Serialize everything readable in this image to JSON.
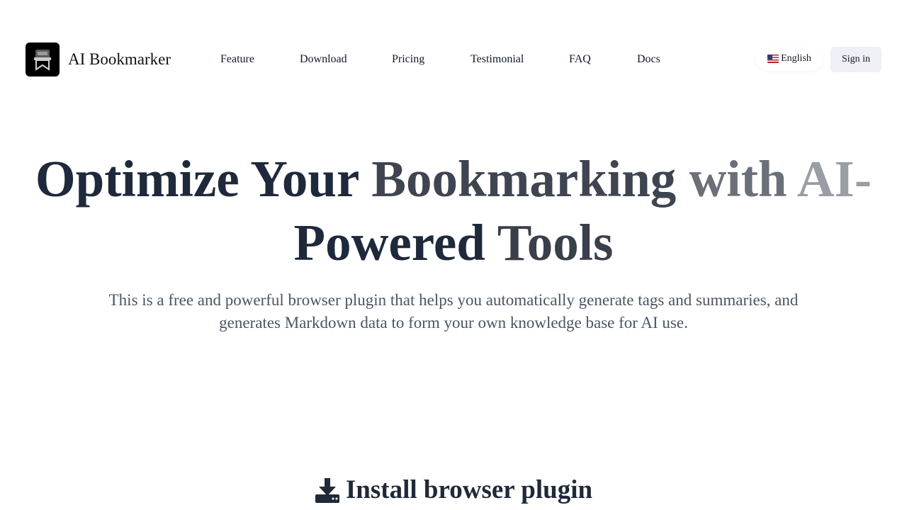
{
  "header": {
    "brand": "AI Bookmarker",
    "nav": [
      {
        "label": "Feature"
      },
      {
        "label": "Download"
      },
      {
        "label": "Pricing"
      },
      {
        "label": "Testimonial"
      },
      {
        "label": "FAQ"
      },
      {
        "label": "Docs"
      }
    ],
    "language": "English",
    "signin": "Sign in"
  },
  "hero": {
    "title_parts": [
      "Optimize ",
      "Your ",
      "Bookmarking ",
      "with ",
      "AI-",
      "Powered ",
      "Tools"
    ],
    "subtitle": "This is a free and powerful browser plugin that helps you automatically generate tags and summaries, and generates Markdown data to form your own knowledge base for AI use."
  },
  "install": {
    "heading": "Install browser plugin",
    "icon": "download-icon"
  },
  "colors": {
    "title_dark": "#1e293b",
    "subtitle": "#4b5563",
    "signin_bg": "#eef0f5"
  }
}
